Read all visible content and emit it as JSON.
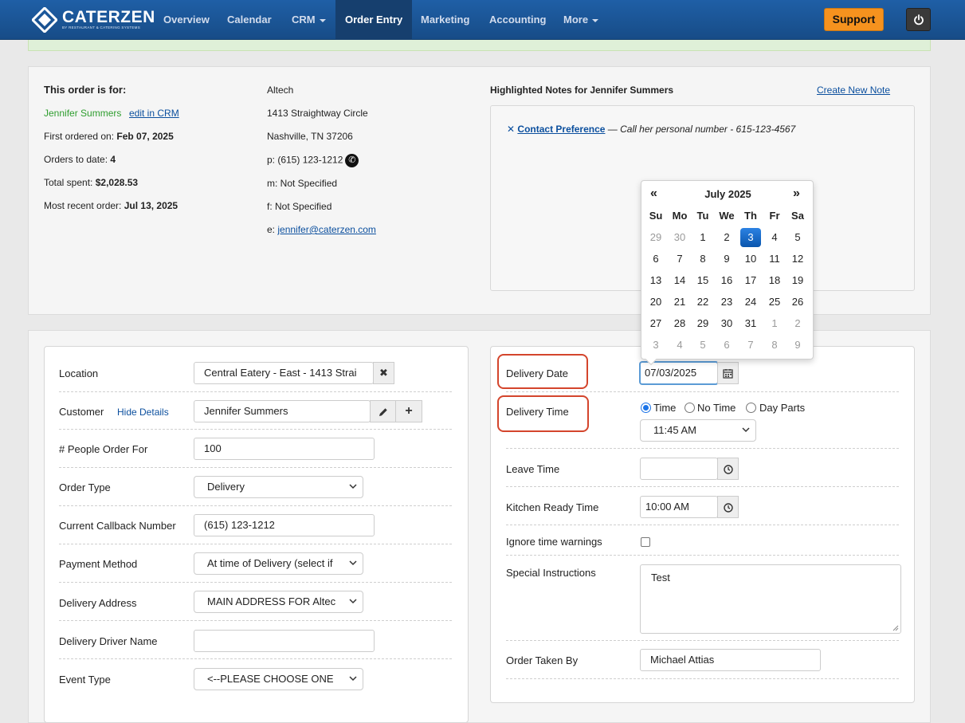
{
  "nav": {
    "logo_text": "CATERZEN",
    "logo_sub": "BY RESTAURANT & CATERING SYSTEMS",
    "items": [
      {
        "label": "Overview"
      },
      {
        "label": "Calendar"
      },
      {
        "label": "CRM"
      },
      {
        "label": "Order Entry"
      },
      {
        "label": "Marketing"
      },
      {
        "label": "Accounting"
      },
      {
        "label": "More"
      }
    ],
    "support_label": "Support"
  },
  "customer_summary": {
    "heading": "This order is for:",
    "name": "Jennifer Summers",
    "edit_link": "edit in CRM",
    "first_ordered_label": "First ordered on:",
    "first_ordered": "Feb 07, 2025",
    "orders_to_date_label": "Orders to date:",
    "orders_to_date": "4",
    "total_spent_label": "Total spent:",
    "total_spent": "$2,028.53",
    "recent_order_label": "Most recent order:",
    "recent_order": "Jul 13, 2025",
    "company": "Altech",
    "address1": "1413 Straightway Circle",
    "address2": "Nashville, TN 37206",
    "phone": "p: (615) 123-1212",
    "mobile": "m: Not Specified",
    "fax": "f: Not Specified",
    "email_prefix": "e:",
    "email": "jennifer@caterzen.com"
  },
  "notes": {
    "heading": "Highlighted Notes for Jennifer Summers",
    "create_link": "Create New Note",
    "items": [
      {
        "title": "Contact Preference",
        "dash": "—",
        "text": "Call her personal number - 615-123-4567"
      }
    ]
  },
  "order_form": {
    "location_label": "Location",
    "location_value": "Central Eatery - East - 1413 Strai",
    "customer_label": "Customer",
    "hide_details": "Hide Details",
    "customer_value": "Jennifer Summers",
    "people_label": "# People Order For",
    "people_value": "100",
    "order_type_label": "Order Type",
    "order_type_value": "Delivery",
    "callback_label": "Current Callback Number",
    "callback_value": "(615) 123-1212",
    "payment_label": "Payment Method",
    "payment_value": "At time of Delivery (select if",
    "address_label": "Delivery Address",
    "address_value": "MAIN ADDRESS FOR Altec",
    "driver_label": "Delivery Driver Name",
    "driver_value": "",
    "event_label": "Event Type",
    "event_value": "<--PLEASE CHOOSE ONE"
  },
  "delivery_form": {
    "date_label": "Delivery Date",
    "date_value": "07/03/2025",
    "time_label": "Delivery Time",
    "radio_time": "Time",
    "radio_no_time": "No Time",
    "radio_day_parts": "Day Parts",
    "time_value": "11:45 AM",
    "leave_label": "Leave Time",
    "leave_value": "",
    "kitchen_label": "Kitchen Ready Time",
    "kitchen_value": "10:00 AM",
    "ignore_label": "Ignore time warnings",
    "instructions_label": "Special Instructions",
    "instructions_value": "Test",
    "taken_by_label": "Order Taken By",
    "taken_by_value": "Michael Attias"
  },
  "calendar": {
    "prev": "«",
    "next": "»",
    "month": "July 2025",
    "dow": [
      "Su",
      "Mo",
      "Tu",
      "We",
      "Th",
      "Fr",
      "Sa"
    ],
    "weeks": [
      [
        "29",
        "30",
        "1",
        "2",
        "3",
        "4",
        "5"
      ],
      [
        "6",
        "7",
        "8",
        "9",
        "10",
        "11",
        "12"
      ],
      [
        "13",
        "14",
        "15",
        "16",
        "17",
        "18",
        "19"
      ],
      [
        "20",
        "21",
        "22",
        "23",
        "24",
        "25",
        "26"
      ],
      [
        "27",
        "28",
        "29",
        "30",
        "31",
        "1",
        "2"
      ],
      [
        "3",
        "4",
        "5",
        "6",
        "7",
        "8",
        "9"
      ]
    ],
    "selected": "3"
  }
}
